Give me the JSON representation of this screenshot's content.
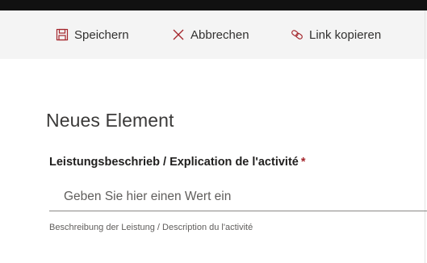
{
  "toolbar": {
    "save_label": "Speichern",
    "cancel_label": "Abbrechen",
    "copy_link_label": "Link kopieren",
    "accent_color": "#a4262c"
  },
  "form": {
    "title": "Neues Element",
    "field": {
      "label": "Leistungsbeschrieb / Explication de l'activité",
      "required_marker": "*",
      "placeholder": "Geben Sie hier einen Wert ein",
      "value": "",
      "description": "Beschreibung der Leistung / Description du l'activité"
    }
  },
  "icons": {
    "save": "save-icon",
    "cancel": "close-icon",
    "copy_link": "link-icon"
  }
}
